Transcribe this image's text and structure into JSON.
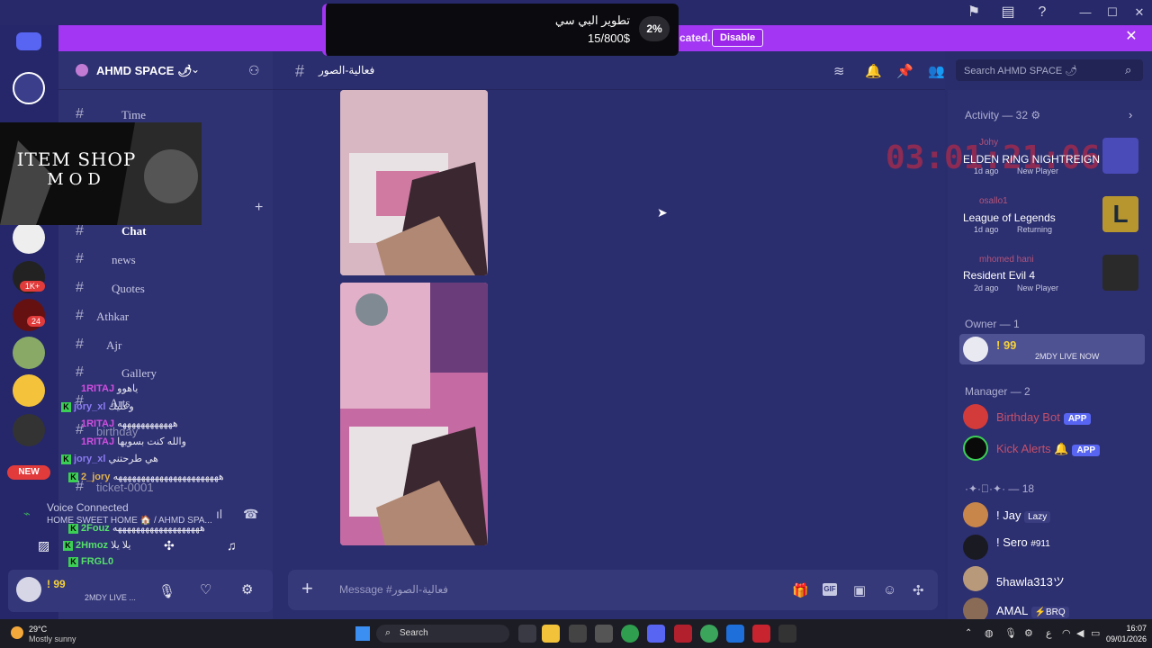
{
  "titlebar": {
    "icons": [
      "pin-icon",
      "inbox-icon",
      "help-icon"
    ],
    "win_controls": [
      "—",
      "☐",
      "✕"
    ]
  },
  "banner": {
    "text": "cated.",
    "disable_label": "Disable"
  },
  "donation": {
    "title": "تطوير البي سي",
    "amount": "15/800$",
    "percent": "2%"
  },
  "rail": {
    "badges": [
      "1K+",
      "24",
      "NEW"
    ]
  },
  "server": {
    "name": "AHMD SPACE 🌶"
  },
  "channels": [
    {
      "name": "Time"
    },
    {
      "name": "Chat"
    },
    {
      "name": "news"
    },
    {
      "name": "Quotes"
    },
    {
      "name": "Athkar"
    },
    {
      "name": "Ajr"
    },
    {
      "name": "Gallery"
    },
    {
      "name": "Arts"
    },
    {
      "name": "birthday"
    },
    {
      "name": "ticket-0001"
    }
  ],
  "overlay": {
    "line1": "ITEM SHOP",
    "line2": "MOD"
  },
  "stream_chat": [
    {
      "user": "1RITAJ",
      "msg": "ياهوو"
    },
    {
      "user": "jory_xl",
      "msg": "وعليك"
    },
    {
      "user": "1RITAJ",
      "msg": "ههههههههههههه"
    },
    {
      "user": "1RITAJ",
      "msg": "والله كنت بسويها"
    },
    {
      "user": "jory_xl",
      "msg": "هي طرحتني"
    },
    {
      "user": "2_jory",
      "msg": "هههههههههههههههههههههههه"
    },
    {
      "user": "2Fouz",
      "msg": "هههههههههههههههههههه"
    },
    {
      "user": "2Hmoz",
      "msg": "يلا يلا"
    },
    {
      "user": "FRGL0",
      "msg": ""
    }
  ],
  "voice": {
    "status": "Voice Connected",
    "location": "HOME SWEET HOME 🏠 / AHMD SPA..."
  },
  "user_panel": {
    "name": "! 99",
    "status": "2MDY LIVE ..."
  },
  "chat": {
    "channel": "فعالية-الصور",
    "placeholder": "Message #فعالية-الصور"
  },
  "search": {
    "placeholder": "Search AHMD SPACE 🌶"
  },
  "timer": "03:01:21:06",
  "activity": {
    "header": "Activity — 32 ⚙",
    "items": [
      {
        "user": "Johy",
        "game": "ELDEN RING NIGHTREIGN",
        "ago": "1d ago",
        "tag": "New Player"
      },
      {
        "user": "osallo1",
        "game": "League of Legends",
        "ago": "1d ago",
        "tag": "Returning"
      },
      {
        "user": "mhomed hani",
        "game": "Resident Evil 4",
        "ago": "2d ago",
        "tag": "New Player"
      }
    ]
  },
  "members": {
    "owner_header": "Owner — 1",
    "owner": {
      "name": "! 99",
      "status": "2MDY LIVE NOW"
    },
    "manager_header": "Manager — 2",
    "managers": [
      {
        "name": "Birthday Bot",
        "badge": "APP"
      },
      {
        "name": "Kick Alerts 🔔",
        "badge": "APP"
      }
    ],
    "group_header": "·✦·ﾟ·✦· — 18",
    "group": [
      {
        "name": "! Jay",
        "tag": "Lazy"
      },
      {
        "name": "! Sero",
        "tag": "#911"
      },
      {
        "name": "5hawla313ツ",
        "tag": ""
      },
      {
        "name": "AMAL",
        "tag": "⚡BRQ"
      }
    ]
  },
  "taskbar": {
    "weather_temp": "29°C",
    "weather_desc": "Mostly sunny",
    "search": "Search",
    "time": "16:07",
    "date": "09/01/2026"
  }
}
